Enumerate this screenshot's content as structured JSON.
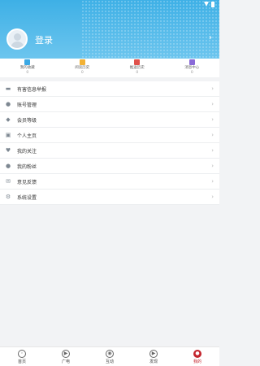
{
  "header": {
    "login_label": "登录",
    "arrow_glyph": "›",
    "colors": {
      "bg_top": "#3eb0e6",
      "bg_bottom": "#6cc5ee"
    }
  },
  "quick": [
    {
      "label": "我的收藏",
      "count": "0",
      "icon": "star-icon",
      "color": "#3aa8e4"
    },
    {
      "label": "阅读历史",
      "count": "0",
      "icon": "document-icon",
      "color": "#f2b134"
    },
    {
      "label": "推送历史",
      "count": "0",
      "icon": "bookmark-icon",
      "color": "#e0524c"
    },
    {
      "label": "消息中心",
      "count": "0",
      "icon": "message-icon",
      "color": "#8a6ad8"
    }
  ],
  "menu": [
    {
      "label": "有害信息举报",
      "icon": "report-icon",
      "glyph": "▬"
    },
    {
      "label": "账号管理",
      "icon": "user-icon",
      "glyph": "●"
    },
    {
      "label": "会员等级",
      "icon": "diamond-icon",
      "glyph": "◆"
    },
    {
      "label": "个人主页",
      "icon": "profile-card-icon",
      "glyph": "▣"
    },
    {
      "label": "我的关注",
      "icon": "heart-icon",
      "glyph": "♥"
    },
    {
      "label": "我的粉丝",
      "icon": "user-icon",
      "glyph": "●"
    },
    {
      "label": "意见反馈",
      "icon": "mail-icon",
      "glyph": "✉"
    },
    {
      "label": "系统设置",
      "icon": "gear-icon",
      "glyph": "⚙"
    }
  ],
  "menu_arrow": "›",
  "tabs": [
    {
      "label": "首页",
      "icon": "home-icon",
      "glyph": "◦"
    },
    {
      "label": "广电",
      "icon": "play-icon",
      "glyph": "▶"
    },
    {
      "label": "互动",
      "icon": "interact-icon",
      "glyph": "◉"
    },
    {
      "label": "发现",
      "icon": "discover-icon",
      "glyph": "▶"
    },
    {
      "label": "我的",
      "icon": "me-icon",
      "glyph": "●"
    }
  ],
  "active_tab": "我的",
  "accent_color": "#c3242c"
}
